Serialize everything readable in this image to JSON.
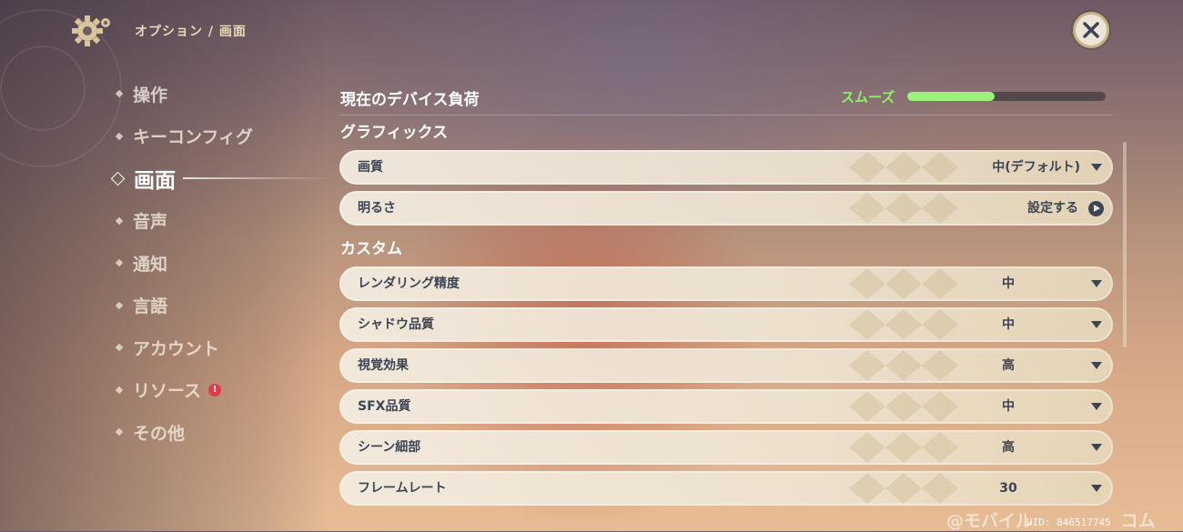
{
  "header": {
    "breadcrumb": "オプション / 画面",
    "settings_icon": "gear-icon",
    "close_icon": "close-icon"
  },
  "nav": {
    "items": [
      {
        "label": "操作"
      },
      {
        "label": "キーコンフィグ"
      },
      {
        "label": "画面",
        "active": true
      },
      {
        "label": "音声"
      },
      {
        "label": "通知"
      },
      {
        "label": "言語"
      },
      {
        "label": "アカウント"
      },
      {
        "label": "リソース",
        "badge": "!"
      },
      {
        "label": "その他"
      }
    ]
  },
  "device_load": {
    "label": "現在のデバイス負荷",
    "status": "スムーズ",
    "level_fraction": 0.44,
    "status_color": "#8ff06a"
  },
  "graphics": {
    "title": "グラフィックス",
    "rows": [
      {
        "label": "画質",
        "value": "中(デフォルト)",
        "control": "dropdown"
      },
      {
        "label": "明るさ",
        "value": "設定する",
        "control": "button"
      }
    ]
  },
  "custom": {
    "title": "カスタム",
    "rows": [
      {
        "label": "レンダリング精度",
        "value": "中",
        "control": "dropdown"
      },
      {
        "label": "シャドウ品質",
        "value": "中",
        "control": "dropdown"
      },
      {
        "label": "視覚効果",
        "value": "高",
        "control": "dropdown"
      },
      {
        "label": "SFX品質",
        "value": "中",
        "control": "dropdown"
      },
      {
        "label": "シーン細部",
        "value": "高",
        "control": "dropdown"
      },
      {
        "label": "フレームレート",
        "value": "30",
        "control": "dropdown"
      }
    ]
  },
  "footer": {
    "watermark": "@モバイル",
    "watermark_tail": "コム",
    "uid": "UID: 846517745"
  },
  "colors": {
    "accent": "#c9b48a",
    "row_text": "#3d4555",
    "alert": "#e4394a"
  }
}
